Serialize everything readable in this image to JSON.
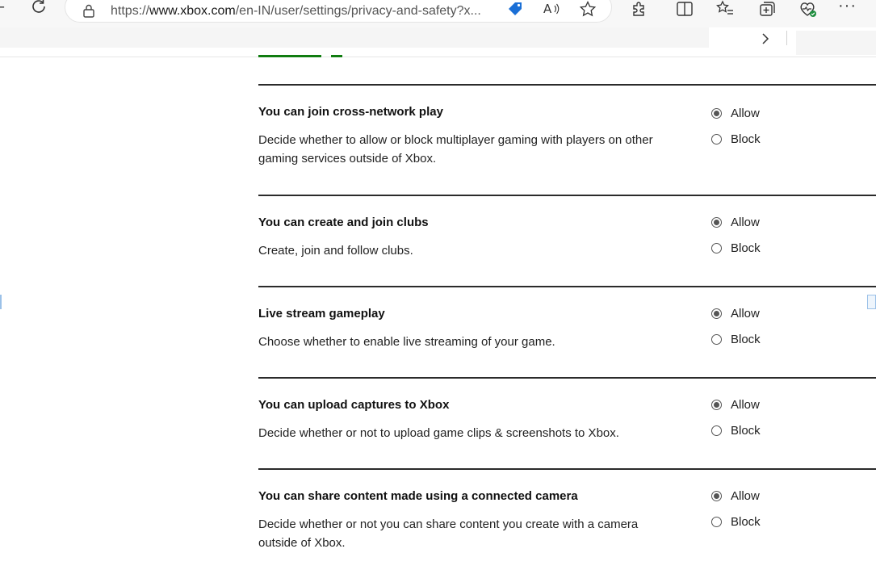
{
  "browser": {
    "url_prefix": "https://",
    "url_domain": "www.xbox.com",
    "url_rest": "/en-IN/user/settings/privacy-and-safety?x...",
    "more_label": "···"
  },
  "settings": [
    {
      "title": "You can join cross-network play",
      "description": "Decide whether to allow or block multiplayer gaming with players on other gaming services outside of Xbox.",
      "options": [
        "Allow",
        "Block"
      ],
      "selected": "Allow"
    },
    {
      "title": "You can create and join clubs",
      "description": "Create, join and follow clubs.",
      "options": [
        "Allow",
        "Block"
      ],
      "selected": "Allow"
    },
    {
      "title": "Live stream gameplay",
      "description": "Choose whether to enable live streaming of your game.",
      "options": [
        "Allow",
        "Block"
      ],
      "selected": "Allow"
    },
    {
      "title": "You can upload captures to Xbox",
      "description": "Decide whether or not to upload game clips & screenshots to Xbox.",
      "options": [
        "Allow",
        "Block"
      ],
      "selected": "Allow"
    },
    {
      "title": "You can share content made using a connected camera",
      "description": "Decide whether or not you can share content you create with a camera outside of Xbox.",
      "options": [
        "Allow",
        "Block"
      ],
      "selected": "Allow"
    }
  ],
  "colors": {
    "accent_green": "#107c10",
    "divider": "#2b2b2b",
    "radio": "#555555"
  }
}
